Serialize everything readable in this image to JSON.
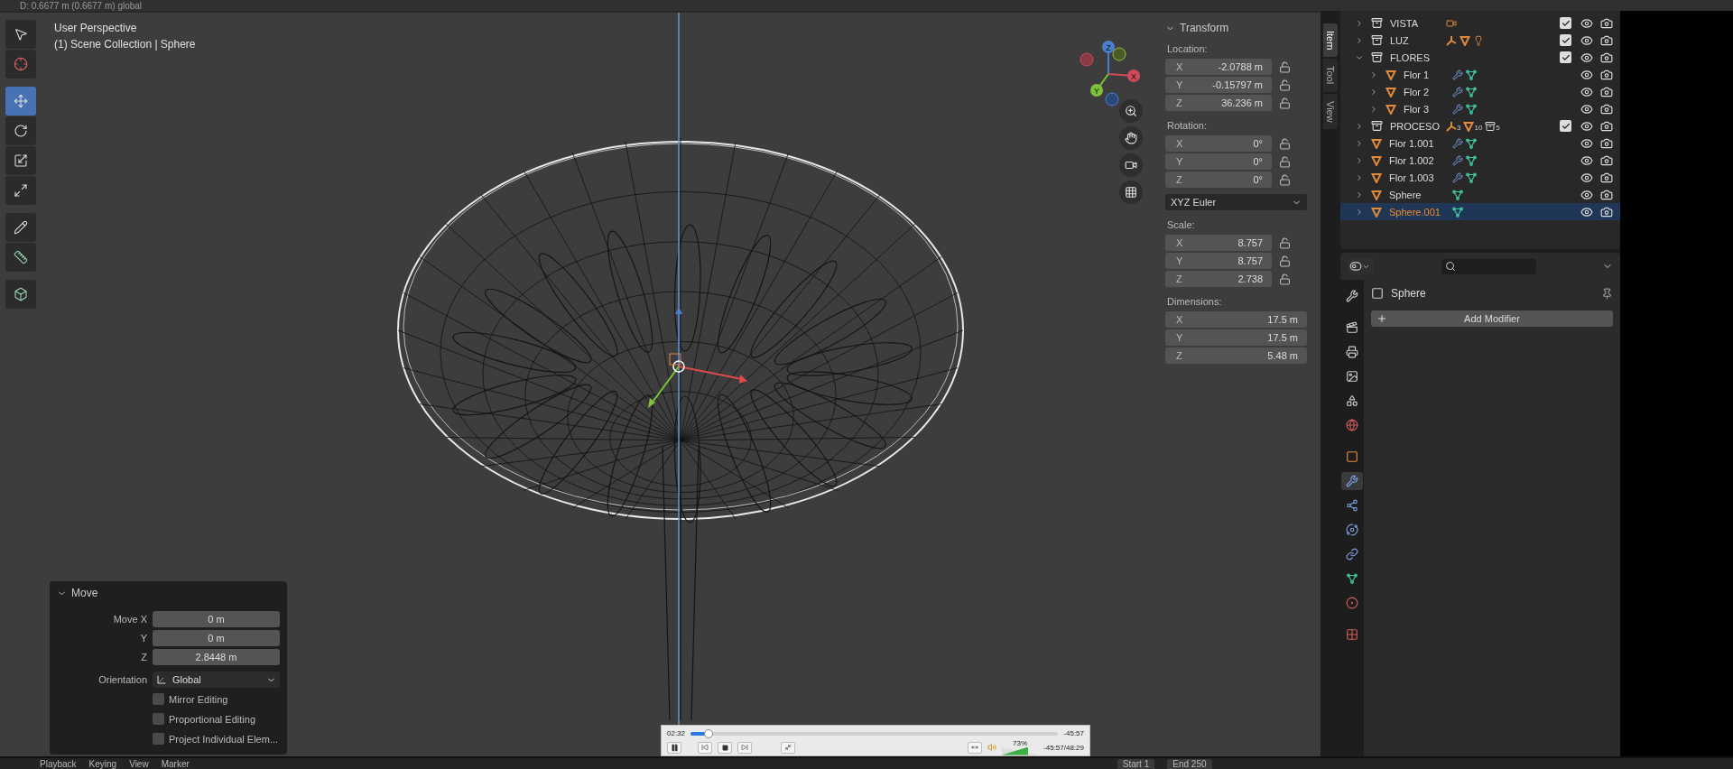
{
  "header": {
    "info": "D: 0.6677 m (0.6677 m) global"
  },
  "viewport": {
    "view_name": "User Perspective",
    "context": "(1) Scene Collection | Sphere"
  },
  "toolbar": [
    {
      "kind": "select",
      "selected": false
    },
    {
      "kind": "cursor",
      "selected": false
    },
    {
      "kind": "move",
      "selected": true
    },
    {
      "kind": "rotate",
      "selected": false
    },
    {
      "kind": "scale",
      "selected": false
    },
    {
      "kind": "transform",
      "selected": false
    },
    {
      "kind": "annotate",
      "selected": false
    },
    {
      "kind": "measure",
      "selected": false
    },
    {
      "kind": "add",
      "selected": false
    }
  ],
  "gizmo": {
    "z": "Z",
    "x": "X",
    "y": "Y"
  },
  "nav_buttons": [
    {
      "kind": "zoom"
    },
    {
      "kind": "pan"
    },
    {
      "kind": "camera"
    },
    {
      "kind": "ortho"
    }
  ],
  "transform": {
    "title": "Transform",
    "groups": [
      {
        "label": "Location:",
        "locks": true,
        "fields": [
          {
            "axis": "X",
            "value": "-2.0788 m"
          },
          {
            "axis": "Y",
            "value": "-0.15797 m"
          },
          {
            "axis": "Z",
            "value": "36.236 m"
          }
        ]
      },
      {
        "label": "Rotation:",
        "locks": true,
        "mode": "XYZ Euler",
        "fields": [
          {
            "axis": "X",
            "value": "0°"
          },
          {
            "axis": "Y",
            "value": "0°"
          },
          {
            "axis": "Z",
            "value": "0°"
          }
        ]
      },
      {
        "label": "Scale:",
        "locks": true,
        "fields": [
          {
            "axis": "X",
            "value": "8.757"
          },
          {
            "axis": "Y",
            "value": "8.757"
          },
          {
            "axis": "Z",
            "value": "2.738"
          }
        ]
      },
      {
        "label": "Dimensions:",
        "locks": false,
        "fields": [
          {
            "axis": "X",
            "value": "17.5 m"
          },
          {
            "axis": "Y",
            "value": "17.5 m"
          },
          {
            "axis": "Z",
            "value": "5.48 m"
          }
        ]
      }
    ]
  },
  "sidebar_tabs": [
    {
      "label": "Item",
      "selected": true
    },
    {
      "label": "Tool",
      "selected": false
    },
    {
      "label": "View",
      "selected": false
    }
  ],
  "outliner": {
    "items": [
      {
        "name": "VISTA",
        "kind": "collection",
        "expanded": false,
        "selected": false,
        "checked": true,
        "badges": [
          {
            "kind": "camera"
          }
        ]
      },
      {
        "name": "LUZ",
        "kind": "collection",
        "expanded": false,
        "selected": false,
        "checked": true,
        "badges": [
          {
            "kind": "armature"
          },
          {
            "kind": "mesh"
          },
          {
            "kind": "light"
          }
        ]
      },
      {
        "name": "FLORES",
        "kind": "collection",
        "expanded": true,
        "selected": false,
        "checked": true,
        "children": [
          {
            "name": "Flor 1",
            "kind": "object",
            "expanded": false,
            "selected": false,
            "badges": [
              {
                "kind": "modifier"
              },
              {
                "kind": "data"
              }
            ]
          },
          {
            "name": "Flor 2",
            "kind": "object",
            "expanded": false,
            "selected": false,
            "badges": [
              {
                "kind": "modifier"
              },
              {
                "kind": "data"
              }
            ]
          },
          {
            "name": "Flor 3",
            "kind": "object",
            "expanded": false,
            "selected": false,
            "badges": [
              {
                "kind": "modifier"
              },
              {
                "kind": "data"
              }
            ]
          }
        ]
      },
      {
        "name": "PROCESO",
        "kind": "collection",
        "expanded": false,
        "selected": false,
        "checked": true,
        "badges": [
          {
            "kind": "armature",
            "count": "3"
          },
          {
            "kind": "mesh",
            "count": "10"
          },
          {
            "kind": "collection",
            "count": "5"
          }
        ]
      },
      {
        "name": "Flor 1.001",
        "kind": "object",
        "expanded": false,
        "selected": false,
        "badges": [
          {
            "kind": "modifier"
          },
          {
            "kind": "data"
          }
        ]
      },
      {
        "name": "Flor 1.002",
        "kind": "object",
        "expanded": false,
        "selected": false,
        "badges": [
          {
            "kind": "modifier"
          },
          {
            "kind": "data"
          }
        ]
      },
      {
        "name": "Flor 1.003",
        "kind": "object",
        "expanded": false,
        "selected": false,
        "badges": [
          {
            "kind": "modifier"
          },
          {
            "kind": "data"
          }
        ]
      },
      {
        "name": "Sphere",
        "kind": "object",
        "expanded": false,
        "selected": false,
        "badges": [
          {
            "kind": "data"
          }
        ]
      },
      {
        "name": "Sphere.001",
        "kind": "object",
        "expanded": false,
        "selected": true,
        "badges": [
          {
            "kind": "data"
          }
        ]
      }
    ]
  },
  "properties": {
    "tabs": [
      {
        "kind": "tool",
        "selected": false
      },
      {
        "kind": "render",
        "selected": false
      },
      {
        "kind": "output",
        "selected": false
      },
      {
        "kind": "view_layer",
        "selected": false
      },
      {
        "kind": "scene",
        "selected": false
      },
      {
        "kind": "world",
        "selected": false
      },
      {
        "kind": "object",
        "selected": false
      },
      {
        "kind": "modifiers",
        "selected": true
      },
      {
        "kind": "particles",
        "selected": false
      },
      {
        "kind": "physics",
        "selected": false
      },
      {
        "kind": "constraints",
        "selected": false
      },
      {
        "kind": "data",
        "selected": false
      },
      {
        "kind": "material",
        "selected": false
      },
      {
        "kind": "texture",
        "selected": false
      }
    ],
    "object": "Sphere",
    "add_button": "Add Modifier"
  },
  "move_panel": {
    "title": "Move",
    "fields": [
      {
        "label": "Move X",
        "value": "0 m"
      },
      {
        "label": "Y",
        "value": "0 m"
      },
      {
        "label": "Z",
        "value": "2.8448 m"
      }
    ],
    "orientation": {
      "label": "Orientation",
      "value": "Global"
    },
    "options": [
      {
        "label": "Mirror Editing",
        "checked": false
      },
      {
        "label": "Proportional Editing",
        "checked": false
      },
      {
        "label": "Project Individual Elem...",
        "checked": false
      }
    ]
  },
  "video_player": {
    "elapsed": "02:32",
    "remaining": "-45:57",
    "progress": {
      "level": 0.05
    },
    "volume": {
      "level": 0.73,
      "reading": "73%"
    },
    "time": "-45:57/48:29"
  },
  "timeline": {
    "menus": [
      "Playback",
      "Keying",
      "View",
      "Marker"
    ],
    "start_label": "Start",
    "start": "1",
    "end_label": "End",
    "end": "250"
  }
}
